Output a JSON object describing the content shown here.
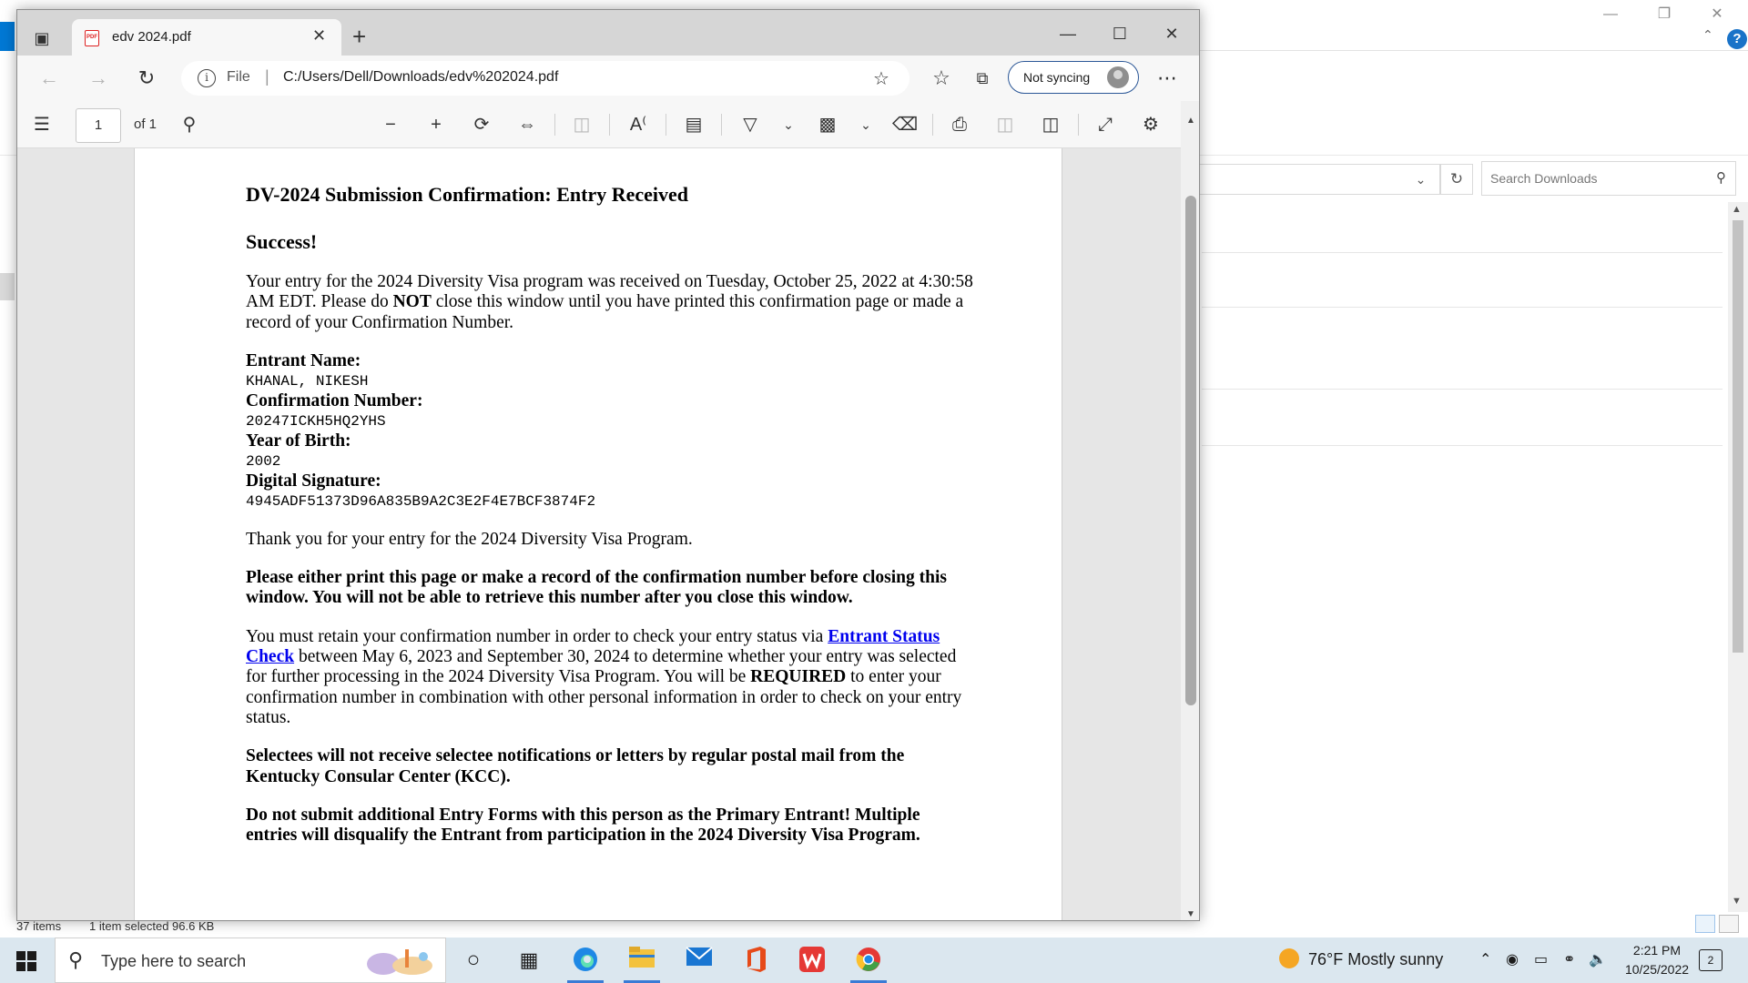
{
  "explorer": {
    "search_placeholder": "Search Downloads",
    "status": {
      "items": "37 items",
      "selected": "1 item selected  96.6 KB"
    }
  },
  "browser": {
    "tab": {
      "title": "edv 2024.pdf"
    },
    "address": {
      "scheme": "File",
      "url": "C:/Users/Dell/Downloads/edv%202024.pdf"
    },
    "sync_label": "Not syncing",
    "pdf_toolbar": {
      "page_current": "1",
      "page_total": "of 1"
    }
  },
  "document": {
    "title": "DV-2024 Submission Confirmation: Entry Received",
    "success": "Success!",
    "intro_before": "Your entry for the 2024 Diversity Visa program was received on Tuesday, October 25, 2022 at 4:30:58 AM EDT. Please do ",
    "intro_bold": "NOT",
    "intro_after": " close this window until you have printed this confirmation page or made a record of your Confirmation Number.",
    "fields": [
      {
        "label": "Entrant Name:",
        "value": "KHANAL, NIKESH"
      },
      {
        "label": "Confirmation Number:",
        "value": "20247ICKH5HQ2YHS"
      },
      {
        "label": "Year of Birth:",
        "value": "2002"
      },
      {
        "label": "Digital Signature:",
        "value": "4945ADF51373D96A835B9A2C3E2F4E7BCF3874F2"
      }
    ],
    "thanks": "Thank you for your entry for the 2024 Diversity Visa Program.",
    "warning_print": "Please either print this page or make a record of the confirmation number before closing this window. You will not be able to retrieve this number after you close this window.",
    "retain_before": "You must retain your confirmation number in order to check your entry status via ",
    "retain_link": "Entrant Status Check",
    "retain_middle": " between May 6, 2023 and September 30, 2024 to determine whether your entry was selected for further processing in the 2024 Diversity Visa Program. You will be ",
    "retain_bold": "REQUIRED",
    "retain_after": " to enter your confirmation number in combination with other personal information in order to check on your entry status.",
    "selectees": "Selectees will not receive selectee notifications or letters by regular postal mail from the Kentucky Consular Center (KCC).",
    "no_additional": "Do not submit additional Entry Forms with this person as the Primary Entrant! Multiple entries will disqualify the Entrant from participation in the 2024 Diversity Visa Program."
  },
  "taskbar": {
    "search_placeholder": "Type here to search",
    "weather": "76°F  Mostly sunny",
    "time": "2:21 PM",
    "date": "10/25/2022",
    "notification_count": "2"
  },
  "colors": {
    "link": "#0000ee",
    "sync_border": "#2b5797",
    "taskbar": "#dbe7ef",
    "help": "#1a73c8"
  }
}
